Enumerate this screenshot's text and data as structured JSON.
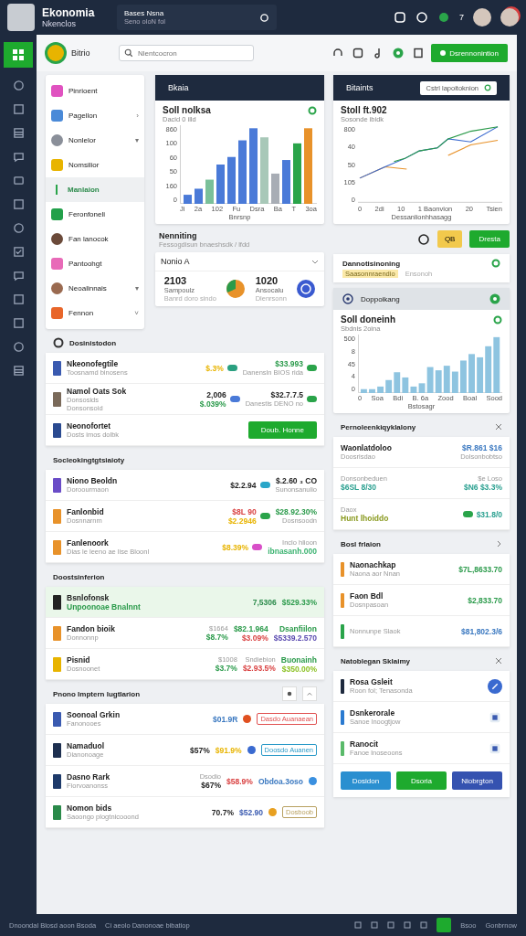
{
  "topbar": {
    "title": "Ekonomia",
    "subtitle": "Nkenclos",
    "search_title": "Bases Nsna",
    "search_sub": "Seno oloN fol",
    "badge": "7"
  },
  "header": {
    "brand": "Bitrio",
    "search_placeholder": "Nlentcocron",
    "button": "Dsrennonintion"
  },
  "nav": [
    {
      "label": "Pinrioent",
      "color": "#e052c0",
      "kind": "tile",
      "selected": false
    },
    {
      "label": "Pagellon",
      "color": "#4a8ad8",
      "kind": "tile",
      "chevron": "›",
      "selected": false
    },
    {
      "label": "Nonlelor",
      "color": "#8a8f99",
      "kind": "avatar",
      "chevron": "▾",
      "selected": false
    },
    {
      "label": "Nomsilior",
      "color": "#e8b400",
      "kind": "tile",
      "selected": false
    },
    {
      "label": "Manlaion",
      "color": "#2aa44a",
      "kind": "bar",
      "selected": true
    },
    {
      "label": "Feronfoneli",
      "color": "#22a04a",
      "kind": "tile",
      "selected": false
    },
    {
      "label": "Fan lanocok",
      "color": "#6b4a3a",
      "kind": "avatar",
      "selected": false
    },
    {
      "label": "Pantoohgt",
      "color": "#e86ab8",
      "kind": "tile",
      "selected": false
    },
    {
      "label": "Neoalinnais",
      "color": "#9a6a50",
      "kind": "avatar",
      "chevron": "▾",
      "selected": false
    },
    {
      "label": "Fennon",
      "color": "#e8662a",
      "kind": "tile",
      "chevron": "˅",
      "selected": false
    }
  ],
  "bar_chart": {
    "header": "Bkaia",
    "title": "Soll nolksa",
    "subtitle": "Dacid 0 illd",
    "yticks": [
      "860",
      "100",
      "60",
      "50",
      "160",
      "0"
    ],
    "xticks": [
      "Ji",
      "2a",
      "102",
      "Fu",
      "Dsra",
      "Ba",
      "T",
      "3oa"
    ],
    "xtitle": "Bnrsnp"
  },
  "line_chart": {
    "header": "Bitaints",
    "input": "Cstrl lapoitoknion",
    "title": "Stoll ft.902",
    "subtitle": "Sosonde ibidk",
    "yticks": [
      "800",
      "40",
      "50",
      "105",
      "0"
    ],
    "xticks": [
      "0",
      "2di",
      "10",
      "1 Baonvion",
      "20",
      "Tsien"
    ],
    "xtitle": "Dessanlionhhasagg"
  },
  "overview": {
    "title": "Nenniting",
    "subtitle": "Fessogdisun bnaeshsdk / lfdd"
  },
  "summary": {
    "title": "Nonio A",
    "stat1": "2103",
    "stat1_sub": "Sampoulz",
    "stat1_note": "Banrd doro sindo",
    "stat2": "1020",
    "stat2_sub": "Ansocalu",
    "stat2_note": "Dlenrsonn"
  },
  "actions": {
    "yellow": "QB",
    "green": "Dresta"
  },
  "progress_card": {
    "title": "Dannotisinoning",
    "tag": "Saasonnraendio",
    "note": "Ensonoh"
  },
  "area_card": {
    "header": "Doppoikang",
    "title": "Soll doneinh",
    "subtitle": "Sbdnis 2oina",
    "yticks": [
      "500",
      "8",
      "45",
      "4",
      "0"
    ],
    "xticks": [
      "0",
      "Soa",
      "Bdi",
      "B. 6a",
      "Zood",
      "Boal",
      "Sood"
    ],
    "xtitle": "Bstosagr"
  },
  "left_sections": [
    {
      "title": "Dosinistodon",
      "kind": "badge",
      "rows": [
        {
          "left": [
            {
              "text": "Nkeonofegtile",
              "kind": "title"
            },
            {
              "text": "Toosnamd binosens",
              "kind": "sub"
            }
          ],
          "cols": [
            {
              "lines": [
                {
                  "text": "$.3%",
                  "kind": "value",
                  "color": "#e8b400"
                }
              ],
              "pill": {
                "color": "#2aa080"
              }
            },
            {
              "lines": [
                {
                  "text": "$33.993",
                  "kind": "value",
                  "color": "#2a9a4a"
                },
                {
                  "text": "Danensln BIOS rida",
                  "kind": "sub"
                }
              ],
              "pill": {
                "color": "#2aa44a"
              }
            }
          ]
        },
        {
          "left": [
            {
              "text": "Namol Oats Sok",
              "kind": "title"
            },
            {
              "text": "Donsosids",
              "kind": "sub"
            },
            {
              "text": "Donsonsoid",
              "kind": "sub"
            }
          ],
          "cols": [
            {
              "lines": [
                {
                  "text": "2,006",
                  "kind": "value",
                  "color": "#222222"
                },
                {
                  "text": "$.039%",
                  "kind": "value",
                  "color": "#2a9a4a"
                }
              ],
              "pill": {
                "color": "#4a7ad8"
              }
            },
            {
              "lines": [
                {
                  "text": "$32.7.7.5",
                  "kind": "value",
                  "color": "#222222"
                },
                {
                  "text": "Danestis DENO no",
                  "kind": "sub"
                }
              ],
              "pill": {
                "color": "#2aa44a"
              }
            }
          ]
        },
        {
          "left": [
            {
              "text": "Neonofortet",
              "kind": "title"
            },
            {
              "text": "Dosts imos dolbk",
              "kind": "sub"
            }
          ],
          "cols": [],
          "button": "Doub. Honne"
        }
      ]
    },
    {
      "title": "Socleokingtgtsiaioty",
      "rows": [
        {
          "left": [
            {
              "text": "Niono Beoldn",
              "kind": "title"
            },
            {
              "text": "Doroourmaon",
              "kind": "sub"
            }
          ],
          "cols": [
            {
              "lines": [
                {
                  "text": "$2.2.94",
                  "kind": "value",
                  "color": "#222222"
                }
              ],
              "pill": {
                "color": "#2aa6c8"
              }
            },
            {
              "lines": [
                {
                  "text": "$.2.60 ₃ CO",
                  "kind": "value",
                  "color": "#222222"
                },
                {
                  "text": "Sunonsanulio",
                  "kind": "sub"
                }
              ]
            }
          ]
        },
        {
          "left": [
            {
              "text": "Fanlonbid",
              "kind": "title"
            },
            {
              "text": "Dosnnarnm",
              "kind": "sub"
            }
          ],
          "cols": [
            {
              "lines": [
                {
                  "text": "$8L 90",
                  "kind": "value",
                  "color": "#d94040"
                },
                {
                  "text": "$2.2946",
                  "kind": "value",
                  "color": "#e8b400"
                }
              ],
              "pill": {
                "color": "#2aa44a"
              }
            },
            {
              "lines": [
                {
                  "text": "$28.92.30%",
                  "kind": "value",
                  "color": "#2a9a4a"
                },
                {
                  "text": "Dosnsoodn",
                  "kind": "sub"
                }
              ]
            }
          ]
        },
        {
          "left": [
            {
              "text": "Fanlenoork",
              "kind": "title"
            },
            {
              "text": "Dias le leeno ae lise Bloonl",
              "kind": "sub"
            }
          ],
          "cols": [
            {
              "lines": [
                {
                  "text": "$8.39%",
                  "kind": "value",
                  "color": "#e8b400"
                }
              ],
              "pill": {
                "color": "#d84fc8"
              }
            },
            {
              "lines": [
                {
                  "text": "Inclo hlioon",
                  "kind": "sub"
                },
                {
                  "text": "ibnasanh.000",
                  "kind": "value",
                  "color": "#3cb371"
                }
              ]
            }
          ]
        }
      ]
    },
    {
      "title": "Doostsinferion",
      "rows": [
        {
          "highlighted": true,
          "left": [
            {
              "text": "Bsnlofonsk",
              "kind": "title"
            },
            {
              "text": "Unpoonoae Bnalnnt",
              "kind": "value",
              "color": "#2a9a4a"
            }
          ],
          "cols": [
            {
              "lines": [
                {
                  "text": "7,5306",
                  "kind": "value",
                  "color": "#2a8a4a"
                }
              ]
            },
            {
              "lines": [
                {
                  "text": "$529.33%",
                  "kind": "value",
                  "color": "#2a9a4a"
                }
              ]
            }
          ]
        },
        {
          "highlighted": false,
          "left": [
            {
              "text": "Fandon bioik",
              "kind": "title"
            },
            {
              "text": "Donnonnp",
              "kind": "sub"
            }
          ],
          "cols": [
            {
              "lines": [
                {
                  "text": "$1664",
                  "kind": "sub"
                },
                {
                  "text": "$8.7%",
                  "kind": "value",
                  "color": "#2a9a4a"
                }
              ]
            },
            {
              "lines": [
                {
                  "text": "$82.1.964",
                  "kind": "value",
                  "color": "#2a9a4a"
                },
                {
                  "text": "$3.09%",
                  "kind": "value",
                  "color": "#d94040"
                }
              ]
            },
            {
              "lines": [
                {
                  "text": "Dsanfiilon",
                  "kind": "value",
                  "color": "#2a9a4a"
                },
                {
                  "text": "$5339.2.570",
                  "kind": "value",
                  "color": "#5a4ab0"
                }
              ]
            }
          ]
        },
        {
          "highlighted": false,
          "left": [
            {
              "text": "Pisnid",
              "kind": "title"
            },
            {
              "text": "Dosnoonet",
              "kind": "sub"
            }
          ],
          "cols": [
            {
              "lines": [
                {
                  "text": "$1008",
                  "kind": "sub"
                },
                {
                  "text": "$3.7%",
                  "kind": "value",
                  "color": "#2a9a4a"
                }
              ]
            },
            {
              "lines": [
                {
                  "text": "Sndiebion",
                  "kind": "sub"
                },
                {
                  "text": "$2.93.5%",
                  "kind": "value",
                  "color": "#d94040"
                }
              ]
            },
            {
              "lines": [
                {
                  "text": "Buonainh",
                  "kind": "value",
                  "color": "#2a9a4a"
                },
                {
                  "text": "$350.00%",
                  "kind": "value",
                  "color": "#8ac020"
                }
              ]
            }
          ]
        }
      ]
    },
    {
      "title": "Pnono Imptern lugtlarion",
      "kind": "tools",
      "rows": [
        {
          "left": [
            {
              "text": "Soonoal Grkin",
              "kind": "title"
            },
            {
              "text": "Fanonooes",
              "kind": "sub"
            }
          ],
          "cols": [
            {
              "lines": [
                {
                  "text": "$01.9R",
                  "kind": "value",
                  "color": "#3a78c0"
                }
              ]
            }
          ],
          "dot": {
            "color": "#e05020"
          },
          "chip": {
            "text": "Dasdo Auanaean",
            "color": "#e05050"
          }
        },
        {
          "left": [
            {
              "text": "Namaduol",
              "kind": "title"
            },
            {
              "text": "Dianonoage",
              "kind": "sub"
            }
          ],
          "cols": [
            {
              "lines": [
                {
                  "text": "$57%",
                  "kind": "value",
                  "color": "#222222"
                }
              ]
            },
            {
              "lines": [
                {
                  "text": "$91.9%",
                  "kind": "value",
                  "color": "#e8b400"
                }
              ]
            }
          ],
          "dot": {
            "color": "#3a6ad0"
          },
          "chip": {
            "text": "Doosdo Auanen",
            "color": "#2a9ac8"
          }
        },
        {
          "left": [
            {
              "text": "Dasno Rark",
              "kind": "title"
            },
            {
              "text": "Fiorvoanonss",
              "kind": "sub"
            }
          ],
          "cols": [
            {
              "lines": [
                {
                  "text": "Dsodio",
                  "kind": "sub"
                },
                {
                  "text": "$67%",
                  "kind": "value",
                  "color": "#222222"
                }
              ]
            },
            {
              "lines": [
                {
                  "text": "$58.9%",
                  "kind": "value",
                  "color": "#d94040"
                }
              ]
            },
            {
              "lines": [
                {
                  "text": "Obdoa.3oso",
                  "kind": "value",
                  "color": "#3a78c0"
                }
              ]
            }
          ],
          "dot": {
            "color": "#3a90e0"
          }
        },
        {
          "left": [
            {
              "text": "Nomon bids",
              "kind": "title"
            },
            {
              "text": "Saoongo plogtnicooond",
              "kind": "sub"
            }
          ],
          "cols": [
            {
              "lines": [
                {
                  "text": "70.7%",
                  "kind": "value",
                  "color": "#222222"
                }
              ]
            },
            {
              "lines": [
                {
                  "text": "$52.90",
                  "kind": "value",
                  "color": "#3a5ab0"
                }
              ]
            }
          ],
          "dot": {
            "color": "#e8a020"
          },
          "chip": {
            "text": "Dosboob",
            "color": "#b8a060"
          }
        }
      ]
    }
  ],
  "right_sections": [
    {
      "title": "Pernoleenkiqyklalony",
      "kind": "close",
      "rows": [
        {
          "left": [
            {
              "text": "Waonlatdoloo",
              "kind": "title"
            },
            {
              "text": "Doosrisdao",
              "kind": "sub"
            }
          ],
          "cols": [
            {
              "lines": [
                {
                  "text": "$R.861 $16",
                  "kind": "value",
                  "color": "#3a78c0"
                },
                {
                  "text": "Dolsonbobtso",
                  "kind": "sub"
                }
              ]
            }
          ]
        },
        {
          "left": [
            {
              "text": "Donsonbeduen",
              "kind": "sub"
            },
            {
              "text": "$6SL 8/30",
              "kind": "value",
              "color": "#2aa090"
            }
          ],
          "cols": [
            {
              "lines": [
                {
                  "text": "$e Loso",
                  "kind": "sub"
                },
                {
                  "text": "$N6 $3.3%",
                  "kind": "value",
                  "color": "#2aa090"
                }
              ]
            }
          ]
        },
        {
          "left": [
            {
              "text": "Daox",
              "kind": "sub"
            },
            {
              "text": "Hunt lhoiddo",
              "kind": "value",
              "color": "#8a9a20"
            }
          ],
          "cols": [
            {
              "lines": [
                {
                  "text": "$31.8/0",
                  "kind": "value",
                  "color": "#2aa090"
                }
              ],
              "pill": {
                "color": "#2aa44a"
              }
            }
          ]
        }
      ]
    },
    {
      "title": "Bosl frlaion",
      "kind": "chevron",
      "rows": [
        {
          "left": [
            {
              "text": "Naonachkap",
              "kind": "title"
            },
            {
              "text": "Naona aor Nnan",
              "kind": "sub"
            }
          ],
          "cols": [
            {
              "lines": [
                {
                  "text": "$7L,8633.70",
                  "kind": "value",
                  "color": "#2a9a4a"
                }
              ]
            }
          ]
        },
        {
          "left": [
            {
              "text": "Faon Bdl",
              "kind": "title"
            },
            {
              "text": "Dosnpasoan",
              "kind": "sub"
            }
          ],
          "cols": [
            {
              "lines": [
                {
                  "text": "$2,833.70",
                  "kind": "value",
                  "color": "#2a9a4a"
                }
              ]
            }
          ]
        },
        {
          "left": [
            {
              "text": "Nonnunpe Slaok",
              "kind": "sub"
            }
          ],
          "cols": [
            {
              "lines": [
                {
                  "text": "$81,802.3/6",
                  "kind": "value",
                  "color": "#3a78c0"
                }
              ]
            }
          ]
        }
      ]
    },
    {
      "title": "Natoblegan Sklaimy",
      "kind": "close",
      "rows": [
        {
          "left": [
            {
              "text": "Rosa Gsleit",
              "kind": "title"
            },
            {
              "text": "Roon fol; Tenasonda",
              "kind": "sub"
            }
          ],
          "cols": [],
          "trail": {
            "kind": "circle"
          }
        },
        {
          "left": [
            {
              "text": "Dsnkerorale",
              "kind": "title"
            },
            {
              "text": "Sanoe lnoogtjow",
              "kind": "sub"
            }
          ],
          "cols": [],
          "trail": {
            "kind": "square"
          }
        },
        {
          "left": [
            {
              "text": "Ranocit",
              "kind": "title"
            },
            {
              "text": "Fanoe lnoseoons",
              "kind": "sub"
            }
          ],
          "cols": [],
          "trail": {
            "kind": "square"
          }
        }
      ],
      "buttons": [
        {
          "label": "Dosidon",
          "color": "#2a8fd0"
        },
        {
          "label": "Dsoria",
          "color": "#1eaa2e"
        },
        {
          "label": "Niobrgton",
          "color": "#3552b0"
        }
      ]
    }
  ],
  "status_bar": {
    "left": [
      "Dnoondal Blosd aoon Bsoda",
      "Ci aeolo Danonoae bibatiop"
    ],
    "right": [
      "Bsoo",
      "Gonbrnow"
    ]
  }
}
